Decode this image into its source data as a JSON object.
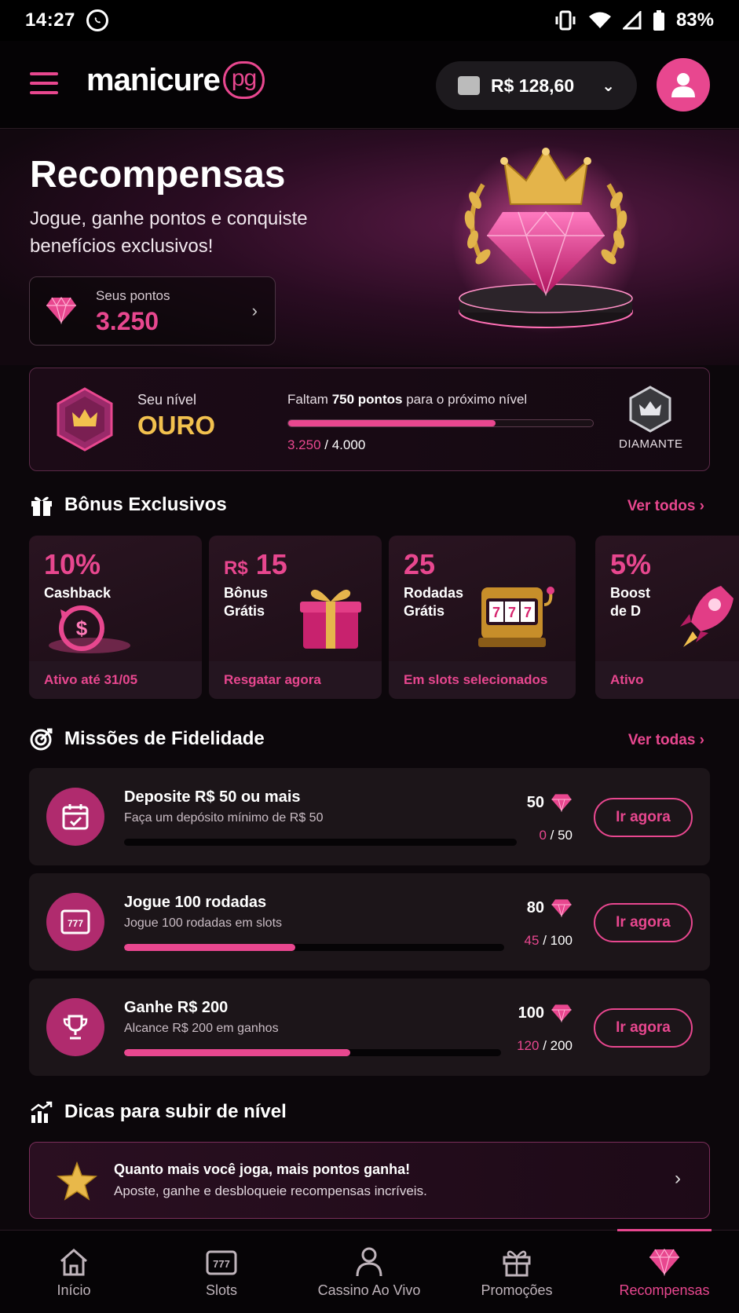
{
  "status_bar": {
    "time": "14:27",
    "battery": "83%"
  },
  "header": {
    "logo_text": "manicure",
    "logo_badge": "pg",
    "balance": "R$ 128,60"
  },
  "hero": {
    "title": "Recompensas",
    "subtitle": "Jogue, ganhe pontos e conquiste benefícios exclusivos!",
    "points_label": "Seus pontos",
    "points_value": "3.250"
  },
  "level": {
    "label": "Seu nível",
    "name": "OURO",
    "missing_prefix": "Faltam",
    "missing_points": "750 pontos",
    "missing_suffix": "para o próximo nível",
    "current": "3.250",
    "target": "/ 4.000",
    "progress_fraction": 0.68,
    "next_level": "DIAMANTE"
  },
  "bonus_section": {
    "title": "Bônus Exclusivos",
    "link": "Ver todos",
    "cards": [
      {
        "big": "10%",
        "sub": "Cashback",
        "foot": "Ativo até 31/05"
      },
      {
        "big_prefix": "R$",
        "big": "15",
        "sub": "Bônus Grátis",
        "foot": "Resgatar agora"
      },
      {
        "big": "25",
        "sub": "Rodadas Grátis",
        "foot": "Em slots selecionados"
      },
      {
        "big": "5%",
        "sub": "Boost de D",
        "foot": "Ativo"
      }
    ]
  },
  "missions_section": {
    "title": "Missões de Fidelidade",
    "link": "Ver todas",
    "items": [
      {
        "title": "Deposite R$ 50 ou mais",
        "desc": "Faça um depósito mínimo de R$ 50",
        "reward": "50",
        "done": "0",
        "total": "/ 50",
        "progress_fraction": 0.0,
        "button": "Ir agora"
      },
      {
        "title": "Jogue 100 rodadas",
        "desc": "Jogue 100 rodadas em slots",
        "reward": "80",
        "done": "45",
        "total": "/ 100",
        "progress_fraction": 0.45,
        "button": "Ir agora"
      },
      {
        "title": "Ganhe R$ 200",
        "desc": "Alcance R$ 200 em ganhos",
        "reward": "100",
        "done": "120",
        "total": "/ 200",
        "progress_fraction": 0.6,
        "button": "Ir agora"
      }
    ]
  },
  "tips_section": {
    "title": "Dicas para subir de nível",
    "line1": "Quanto mais você joga, mais pontos ganha!",
    "line2": "Aposte, ganhe e desbloqueie recompensas incríveis."
  },
  "bottom_nav": [
    {
      "label": "Início",
      "icon": "home-icon"
    },
    {
      "label": "Slots",
      "icon": "slot-machine-icon"
    },
    {
      "label": "Cassino Ao Vivo",
      "icon": "user-icon"
    },
    {
      "label": "Promoções",
      "icon": "gift-icon"
    },
    {
      "label": "Recompensas",
      "icon": "diamond-icon",
      "active": true
    }
  ],
  "colors": {
    "accent": "#e8478f",
    "gold": "#f2c14e",
    "background": "#0c070b"
  }
}
